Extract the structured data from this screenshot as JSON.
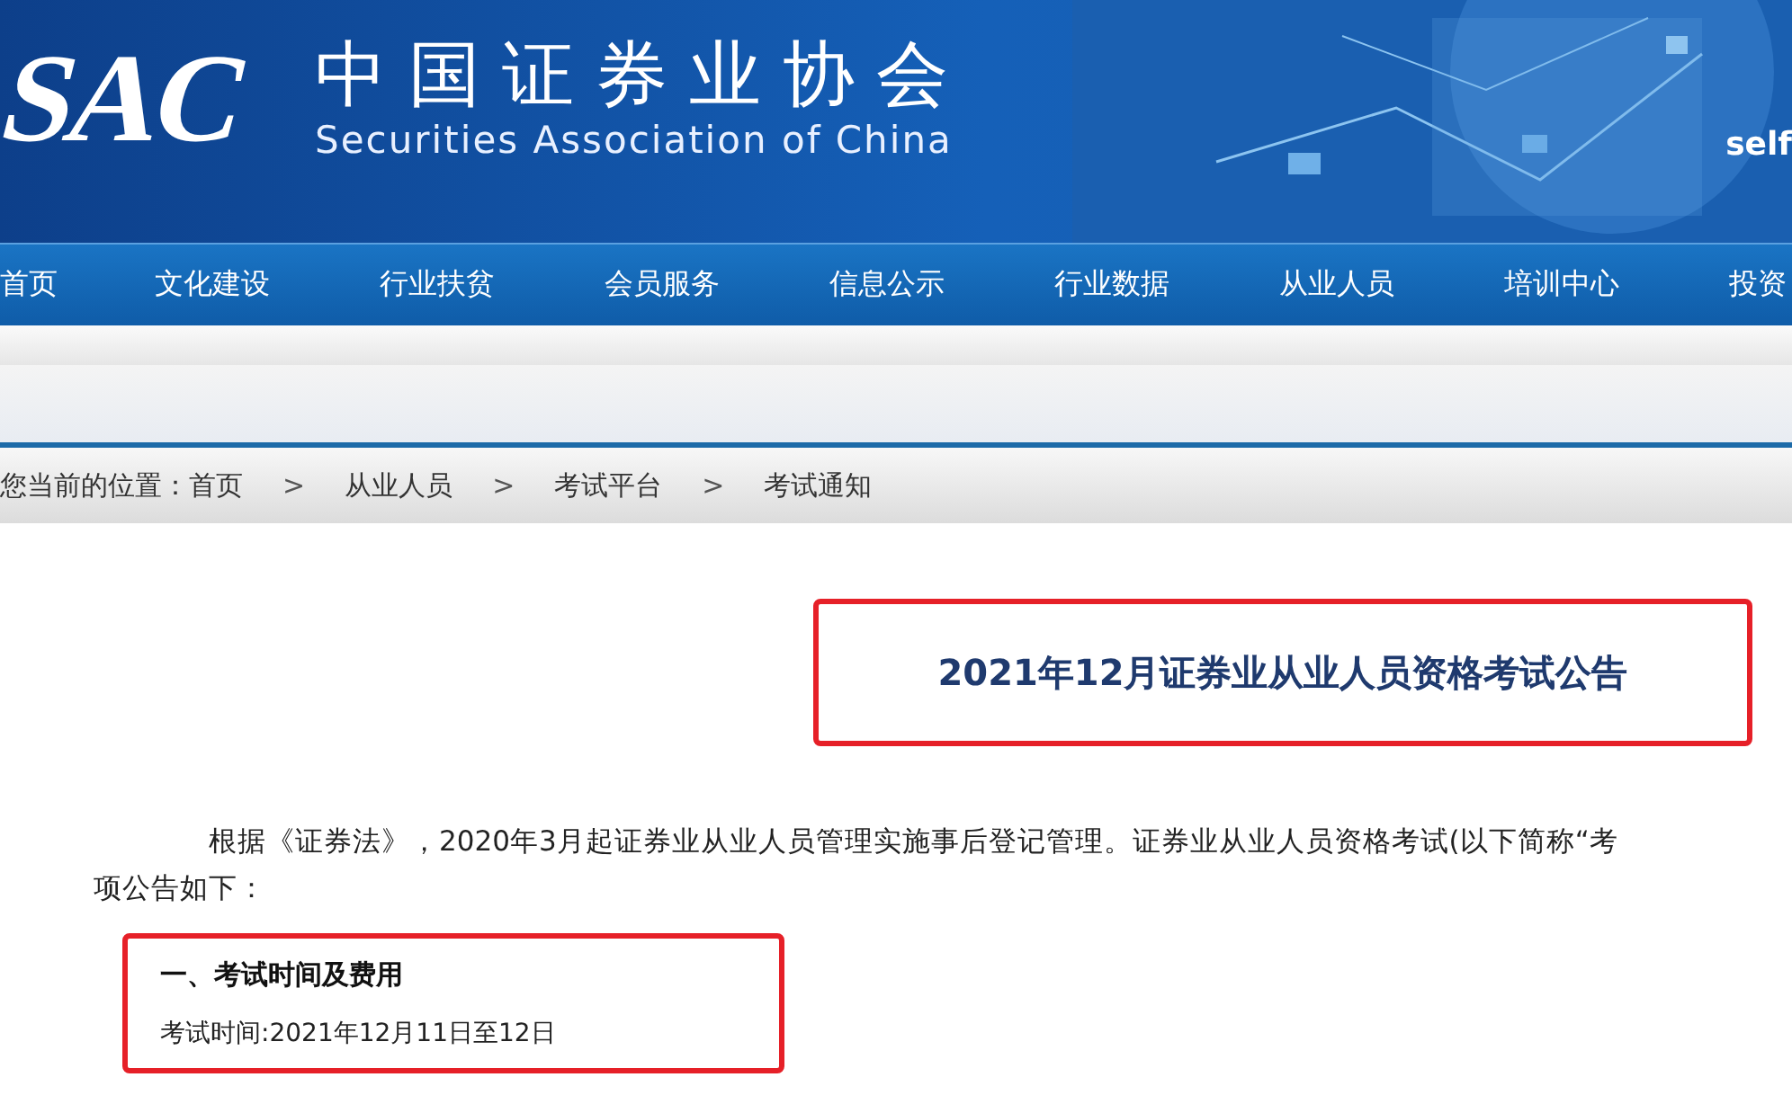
{
  "header": {
    "logo": "SAC",
    "title_cn": "中国证券业协会",
    "title_en": "Securities Association of China",
    "corner_text": "self"
  },
  "nav": [
    {
      "label": "首页"
    },
    {
      "label": "文化建设"
    },
    {
      "label": "行业扶贫"
    },
    {
      "label": "会员服务"
    },
    {
      "label": "信息公示"
    },
    {
      "label": "行业数据"
    },
    {
      "label": "从业人员"
    },
    {
      "label": "培训中心"
    },
    {
      "label": "投资"
    }
  ],
  "breadcrumb": {
    "prefix": "您当前的位置：",
    "items": [
      "首页",
      "从业人员",
      "考试平台",
      "考试通知"
    ],
    "separator": ">"
  },
  "article": {
    "title": "2021年12月证券业从业人员资格考试公告",
    "paragraph_lines": [
      "根据《证券法》，2020年3月起证券业从业人员管理实施事后登记管理。证券业从业人员资格考试(以下简称“考",
      "项公告如下："
    ],
    "section_heading": "一、考试时间及费用",
    "section_line": "考试时间:2021年12月11日至12日"
  }
}
